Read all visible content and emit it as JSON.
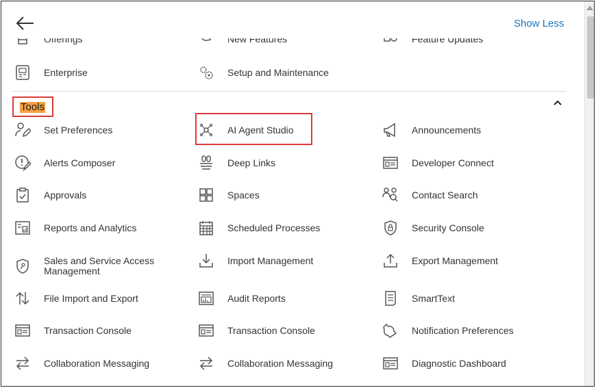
{
  "header": {
    "show_less_label": "Show Less"
  },
  "top_items": {
    "offerings": "Offerings",
    "new_features": "New Features",
    "feature_updates": "Feature Updates",
    "enterprise": "Enterprise",
    "setup_maintenance": "Setup and Maintenance"
  },
  "tools": {
    "title": "Tools",
    "items": {
      "set_preferences": "Set Preferences",
      "ai_agent_studio": "AI Agent Studio",
      "announcements": "Announcements",
      "alerts_composer": "Alerts Composer",
      "deep_links": "Deep Links",
      "developer_connect": "Developer Connect",
      "approvals": "Approvals",
      "spaces": "Spaces",
      "contact_search": "Contact Search",
      "reports_analytics": "Reports and Analytics",
      "scheduled_processes": "Scheduled Processes",
      "security_console": "Security Console",
      "sales_service_access_1": "Sales and Service Access",
      "sales_service_access_2": "Management",
      "import_management": "Import Management",
      "export_management": "Export Management",
      "file_import_export": "File Import and Export",
      "audit_reports": "Audit Reports",
      "smarttext": "SmartText",
      "transaction_console_1": "Transaction Console",
      "transaction_console_2": "Transaction Console",
      "notification_preferences": "Notification Preferences",
      "collaboration_messaging_1": "Collaboration Messaging",
      "collaboration_messaging_2": "Collaboration Messaging",
      "diagnostic_dashboard": "Diagnostic Dashboard"
    }
  }
}
